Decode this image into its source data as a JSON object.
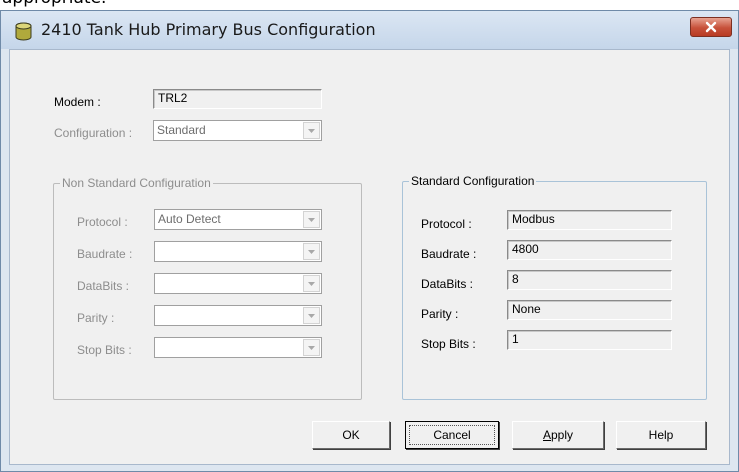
{
  "top_strip_text": "appropriate.",
  "window": {
    "title": "2410 Tank Hub Primary Bus Configuration",
    "icon": "tank-icon"
  },
  "modem": {
    "label": "Modem :",
    "value": "TRL2"
  },
  "configuration": {
    "label": "Configuration :",
    "value": "Standard"
  },
  "non_standard": {
    "title": "Non Standard Configuration",
    "protocol": {
      "label": "Protocol :",
      "value": "Auto Detect"
    },
    "baudrate": {
      "label": "Baudrate :",
      "value": ""
    },
    "databits": {
      "label": "DataBits :",
      "value": ""
    },
    "parity": {
      "label": "Parity :",
      "value": ""
    },
    "stopbits": {
      "label": "Stop Bits :",
      "value": ""
    }
  },
  "standard": {
    "title": "Standard Configuration",
    "protocol": {
      "label": "Protocol :",
      "value": "Modbus"
    },
    "baudrate": {
      "label": "Baudrate :",
      "value": "4800"
    },
    "databits": {
      "label": "DataBits :",
      "value": "8"
    },
    "parity": {
      "label": "Parity :",
      "value": "None"
    },
    "stopbits": {
      "label": "Stop Bits :",
      "value": "1"
    }
  },
  "buttons": {
    "ok": "OK",
    "cancel": "Cancel",
    "apply_mnemonic": "A",
    "apply_rest": "pply",
    "help": "Help"
  },
  "colors": {
    "close_button": "#c7513a",
    "dialog_background": "#f0f0f0",
    "disabled_text": "#8d8d8d"
  }
}
